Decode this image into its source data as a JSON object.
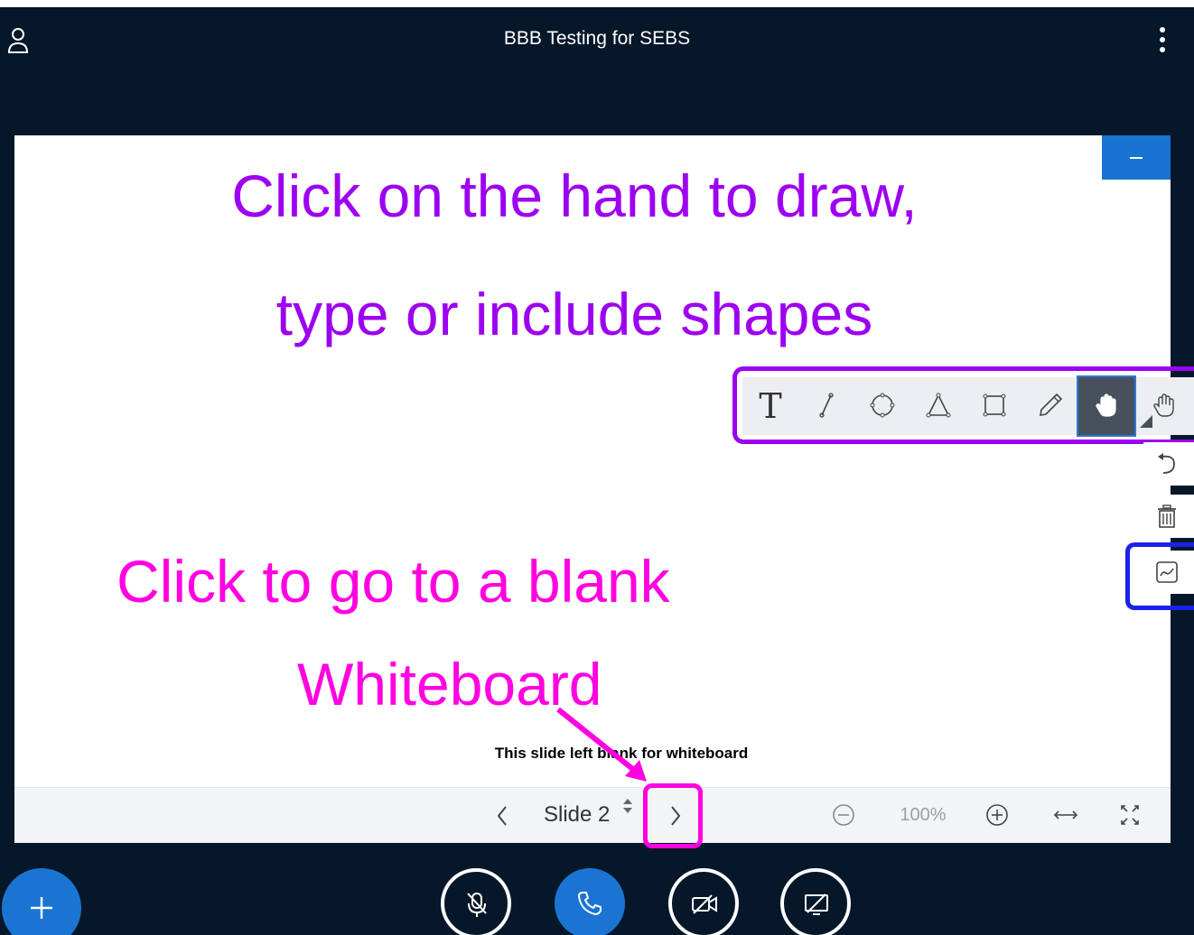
{
  "header": {
    "title": "BBB Testing for SEBS"
  },
  "annotations": {
    "draw_line1": "Click on the hand to draw,",
    "draw_line2": "type or include shapes",
    "blank_line1": "Click to go to a blank",
    "blank_line2": "Whiteboard"
  },
  "slide": {
    "text": "This slide left blank for whiteboard"
  },
  "toolbar": {
    "text_tool": "T",
    "tools": [
      "text-tool",
      "line-tool",
      "ellipse-tool",
      "triangle-tool",
      "rectangle-tool",
      "pencil-tool",
      "hand-tool",
      "hand-tool-dropdown"
    ],
    "active": "hand-tool"
  },
  "side_tools": [
    "undo-icon",
    "trash-icon",
    "multi-user-whiteboard-icon"
  ],
  "navigation": {
    "slide_label": "Slide 2",
    "zoom": "100%"
  },
  "action_bar": [
    "add-icon",
    "mute-microphone-icon",
    "phone-icon",
    "video-off-icon",
    "screen-share-off-icon"
  ],
  "colors": {
    "chrome": "#06172a",
    "accent": "#1873d3",
    "annotation_purple": "#9d00f0",
    "annotation_magenta": "#ff00e1",
    "highlight_blue": "#1a22e8"
  }
}
